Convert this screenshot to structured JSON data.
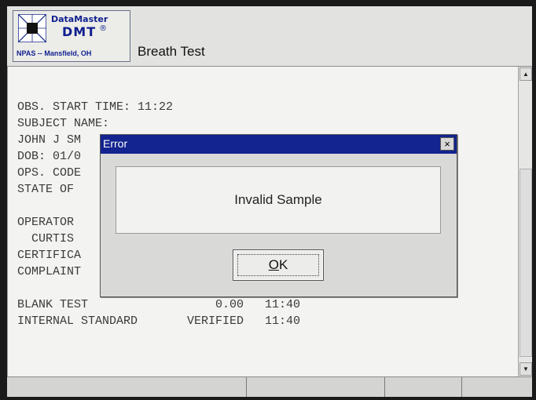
{
  "header": {
    "logo_brand": "DataMaster",
    "logo_model": "DMT",
    "logo_reg": "®",
    "logo_location": "NPAS -- Mansfield, OH",
    "title": "Breath Test"
  },
  "report": {
    "obs_start": "OBS. START TIME: 11:22",
    "subject_label": "SUBJECT NAME:",
    "subject_name": "JOHN J SM",
    "dob": "DOB: 01/0",
    "ops_code": "OPS. CODE",
    "state_of": "STATE OF",
    "operator": "OPERATOR",
    "operator_name": "  CURTIS",
    "certification": "CERTIFICA",
    "complaint": "COMPLAINT",
    "blank_test": "BLANK TEST                  0.00   11:40",
    "internal_standard": "INTERNAL STANDARD       VERIFIED   11:40"
  },
  "scrollbar": {
    "up_icon": "▲",
    "down_icon": "▼"
  },
  "status_bar": [
    "",
    "",
    "",
    ""
  ],
  "dialog": {
    "title": "Error",
    "close_label": "×",
    "message": "Invalid Sample",
    "ok_mnemonic": "O",
    "ok_rest": "K"
  }
}
